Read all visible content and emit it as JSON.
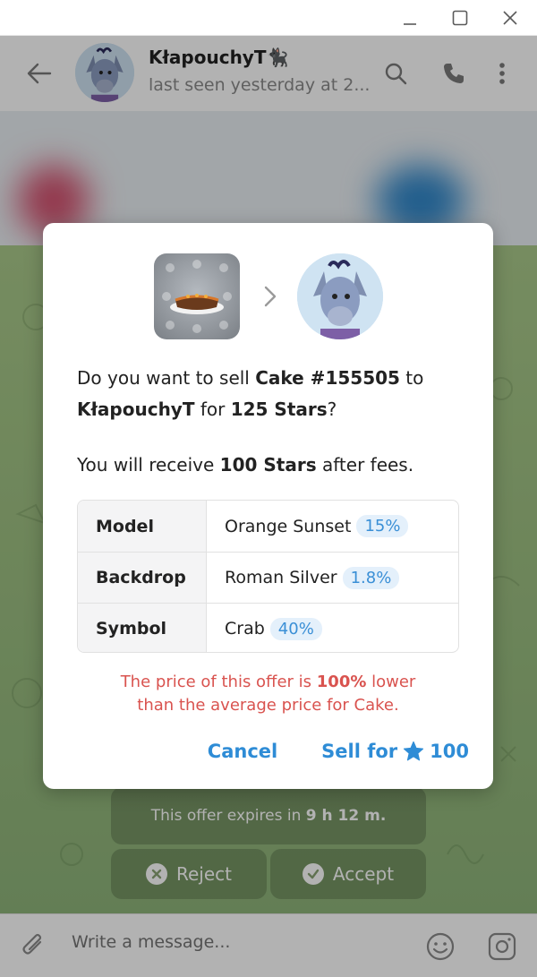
{
  "window": {
    "controls": [
      "minimize",
      "maximize",
      "close"
    ]
  },
  "header": {
    "name": "KłapouchyT🐈‍⬛",
    "status": "last seen yesterday at 2...",
    "icons": [
      "back-arrow-icon",
      "search-icon",
      "phone-icon",
      "more-vertical-icon"
    ]
  },
  "chat": {
    "offer_text": "This offer expires in ",
    "offer_time": "9 h 12 m.",
    "reject_label": "Reject",
    "accept_label": "Accept"
  },
  "composer": {
    "placeholder": "Write a message...",
    "icons": [
      "attach-icon",
      "emoji-icon",
      "sticker-icon"
    ]
  },
  "dialog": {
    "question_prefix": "Do you want to sell ",
    "gift_name": "Cake #155505",
    "question_to": " to ",
    "recipient": "KłapouchyT",
    "question_for": " for ",
    "price": "125 Stars",
    "question_suffix": "?",
    "receive_prefix": "You will receive ",
    "receive_amount": "100 Stars",
    "receive_suffix": " after fees.",
    "attributes": [
      {
        "key": "Model",
        "value": "Orange Sunset",
        "rarity": "15%"
      },
      {
        "key": "Backdrop",
        "value": "Roman Silver",
        "rarity": "1.8%"
      },
      {
        "key": "Symbol",
        "value": "Crab",
        "rarity": "40%"
      }
    ],
    "warning_prefix": "The price of this offer is ",
    "warning_percent": "100%",
    "warning_middle": " lower",
    "warning_line2": "than the average price for Cake.",
    "cancel_label": "Cancel",
    "sell_label": "Sell for",
    "sell_amount": "100"
  },
  "colors": {
    "accent": "#2e8cd6",
    "warning": "#d9534f",
    "badge_bg": "#e4f0fb",
    "chat_bg": "#9fc183"
  }
}
